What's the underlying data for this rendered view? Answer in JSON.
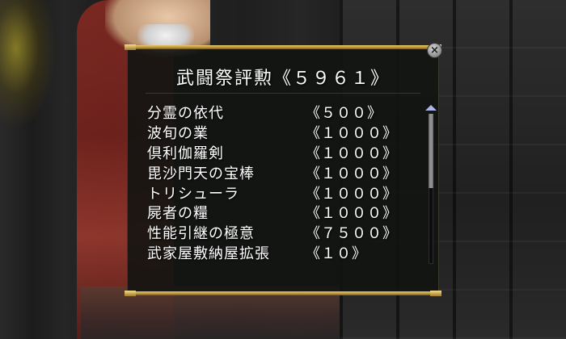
{
  "dialog": {
    "title": "武闘祭評勲《５９６１》",
    "close_label": "×"
  },
  "rewards": [
    {
      "name": "分霊の依代",
      "cost": "《５００》"
    },
    {
      "name": "波旬の業",
      "cost": "《１０００》"
    },
    {
      "name": "倶利伽羅剣",
      "cost": "《１０００》"
    },
    {
      "name": "毘沙門天の宝棒",
      "cost": "《１０００》"
    },
    {
      "name": "トリシューラ",
      "cost": "《１０００》"
    },
    {
      "name": "屍者の糧",
      "cost": "《１０００》"
    },
    {
      "name": "性能引継の極意",
      "cost": "《７５００》"
    },
    {
      "name": "武家屋敷納屋拡張",
      "cost": "《１０》"
    }
  ],
  "icons": {
    "close": "close-icon",
    "scroll_up": "scroll-up-arrow-icon"
  },
  "colors": {
    "panel_bg": "#121412",
    "rail_gold": "#d4b25a",
    "text": "#ffffff",
    "scroll_arrow": "#aeb8e8"
  }
}
